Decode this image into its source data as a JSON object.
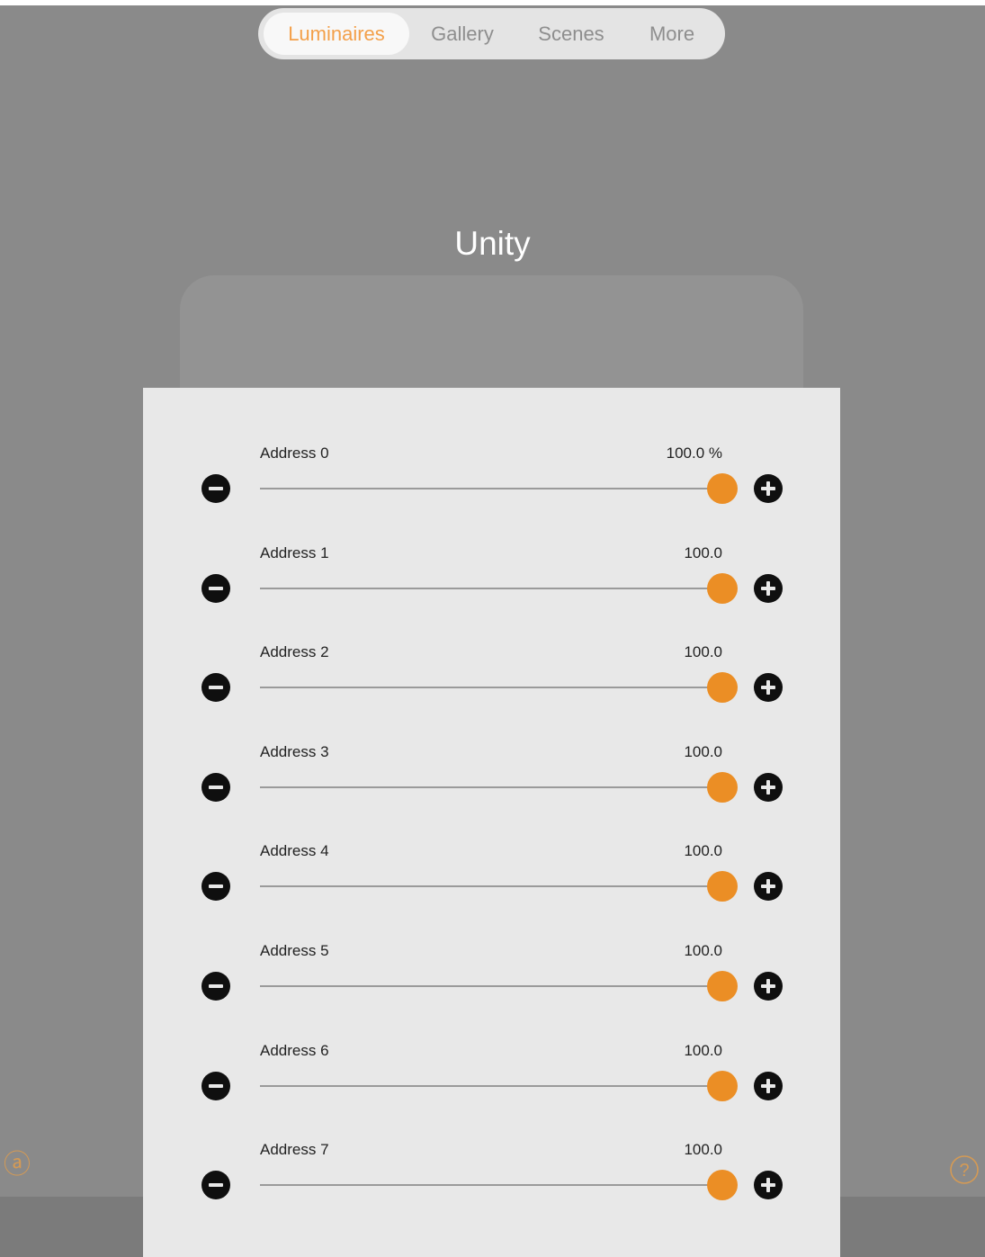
{
  "tabs": [
    {
      "label": "Luminaires",
      "active": true
    },
    {
      "label": "Gallery",
      "active": false
    },
    {
      "label": "Scenes",
      "active": false
    },
    {
      "label": "More",
      "active": false
    }
  ],
  "title": "Unity",
  "accent_color": "#eb8e25",
  "icons": {
    "left_corner": "at-sign-icon",
    "right_corner": "help-circle-icon",
    "left_corner_glyph": "ⓐ",
    "right_corner_glyph": "?"
  },
  "sliders": [
    {
      "label": "Address 0",
      "value_text": "100.0 %",
      "fraction": 1.0
    },
    {
      "label": "Address 1",
      "value_text": "100.0",
      "fraction": 1.0
    },
    {
      "label": "Address 2",
      "value_text": "100.0",
      "fraction": 1.0
    },
    {
      "label": "Address 3",
      "value_text": "100.0",
      "fraction": 1.0
    },
    {
      "label": "Address 4",
      "value_text": "100.0",
      "fraction": 1.0
    },
    {
      "label": "Address 5",
      "value_text": "100.0",
      "fraction": 1.0
    },
    {
      "label": "Address 6",
      "value_text": "100.0",
      "fraction": 1.0
    },
    {
      "label": "Address 7",
      "value_text": "100.0",
      "fraction": 1.0
    }
  ]
}
